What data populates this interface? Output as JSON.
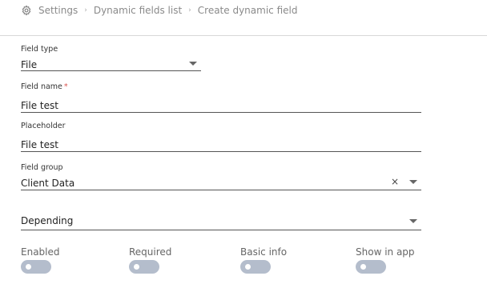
{
  "breadcrumb": {
    "items": [
      "Settings",
      "Dynamic fields list",
      "Create dynamic field"
    ],
    "icon": "gear-icon"
  },
  "form": {
    "field_type": {
      "label": "Field type",
      "value": "File"
    },
    "field_name": {
      "label": "Field name",
      "required_mark": "*",
      "value": "File test"
    },
    "placeholder": {
      "label": "Placeholder",
      "value": "File test"
    },
    "field_group": {
      "label": "Field group",
      "value": "Client Data",
      "clear": "×"
    },
    "depending": {
      "value": "Depending"
    }
  },
  "toggles": [
    {
      "label": "Enabled",
      "state": false
    },
    {
      "label": "Required",
      "state": false
    },
    {
      "label": "Basic info",
      "state": false
    },
    {
      "label": "Show in app",
      "state": false
    }
  ],
  "colors": {
    "toggle_off": "#b4bdcc",
    "required_star": "#d9534f"
  }
}
